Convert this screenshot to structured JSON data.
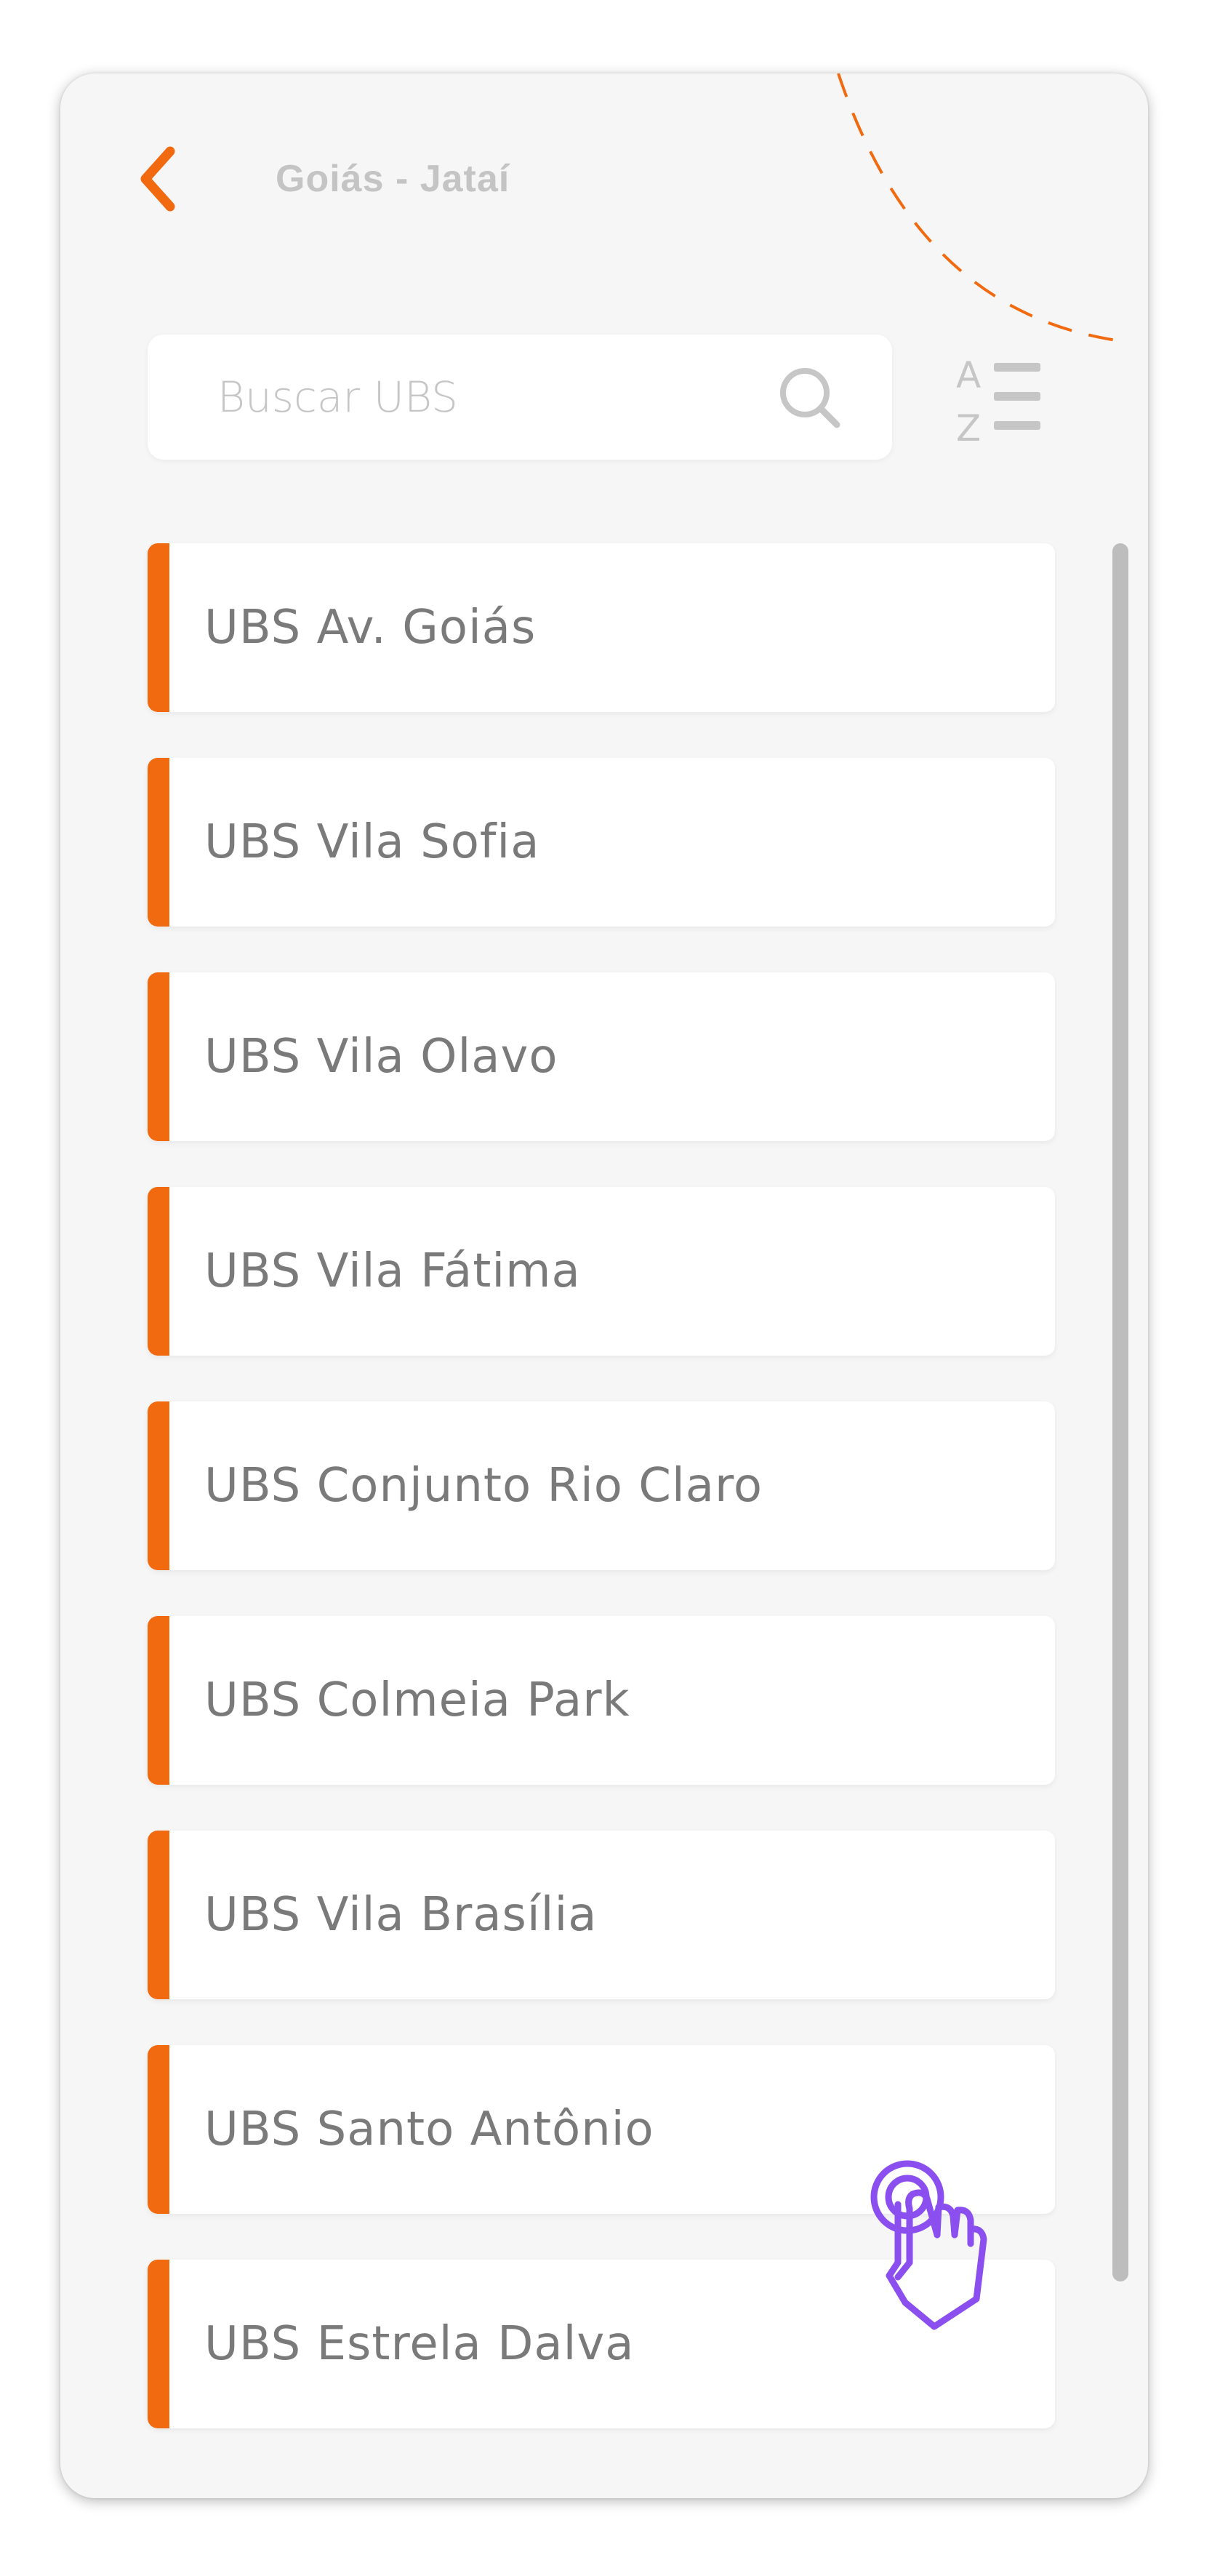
{
  "header": {
    "title": "Goiás - Jataí",
    "back_icon": "chevron-left-icon"
  },
  "search": {
    "placeholder": "Buscar UBS",
    "value": "",
    "icon": "search-icon"
  },
  "sort": {
    "icon": "sort-alpha-icon",
    "letters": [
      "A",
      "Z"
    ]
  },
  "ubs_list": [
    {
      "label": "UBS Av. Goiás"
    },
    {
      "label": "UBS Vila Sofia"
    },
    {
      "label": "UBS Vila Olavo"
    },
    {
      "label": "UBS Vila Fátima"
    },
    {
      "label": "UBS Conjunto Rio Claro"
    },
    {
      "label": "UBS Colmeia Park"
    },
    {
      "label": "UBS Vila Brasília"
    },
    {
      "label": "UBS Santo Antônio"
    },
    {
      "label": "UBS Estrela Dalva"
    }
  ],
  "colors": {
    "accent": "#f26a10",
    "background": "#f6f6f6",
    "card": "#ffffff",
    "text": "#7a7a7a",
    "muted": "#c4c4c4",
    "cursor": "#8b4ff0"
  },
  "cursor_icon": "tap-hand-icon"
}
